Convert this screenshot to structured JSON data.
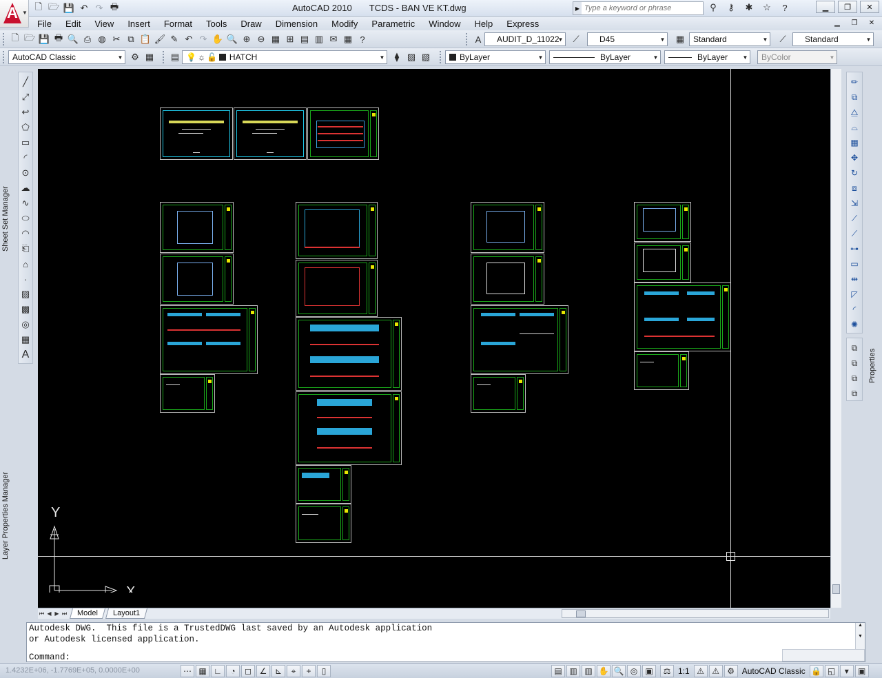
{
  "app": {
    "window_title": "AutoCAD 2010       TCDS - BAN VE KT.dwg",
    "search_placeholder": "Type a keyword or phrase"
  },
  "menu": [
    "File",
    "Edit",
    "View",
    "Insert",
    "Format",
    "Tools",
    "Draw",
    "Dimension",
    "Modify",
    "Parametric",
    "Window",
    "Help",
    "Express"
  ],
  "styles_toolbar": {
    "text_style": "AUDIT_D_11022",
    "dim_style": "D45",
    "table_style": "Standard",
    "multileader_style": "Standard"
  },
  "workspace": "AutoCAD Classic",
  "layer": {
    "current": "HATCH",
    "color": "ByLayer",
    "linetype": "ByLayer",
    "lineweight": "ByLayer",
    "plot_style": "ByColor"
  },
  "palettes": {
    "left_top": "Sheet Set Manager",
    "left_bottom": "Layer Properties Manager",
    "right": "Properties"
  },
  "ucs": {
    "y_label": "Y",
    "x_label": "X"
  },
  "layout_tabs": {
    "model": "Model",
    "layout1": "Layout1"
  },
  "command": {
    "history_1": "Autodesk DWG.  This file is a TrustedDWG last saved by an Autodesk application",
    "history_2": "or Autodesk licensed application.",
    "prompt": "Command:"
  },
  "status": {
    "coordinates": "1.4232E+06, -1.7769E+05, 0.0000E+00",
    "annotation_scale": "1:1",
    "workspace": "AutoCAD Classic"
  },
  "colors": {
    "canvas": "#000000",
    "frame": "#1aa81a",
    "cover_frame": "#1ec8e8",
    "title_block_accent": "#e8e800"
  }
}
